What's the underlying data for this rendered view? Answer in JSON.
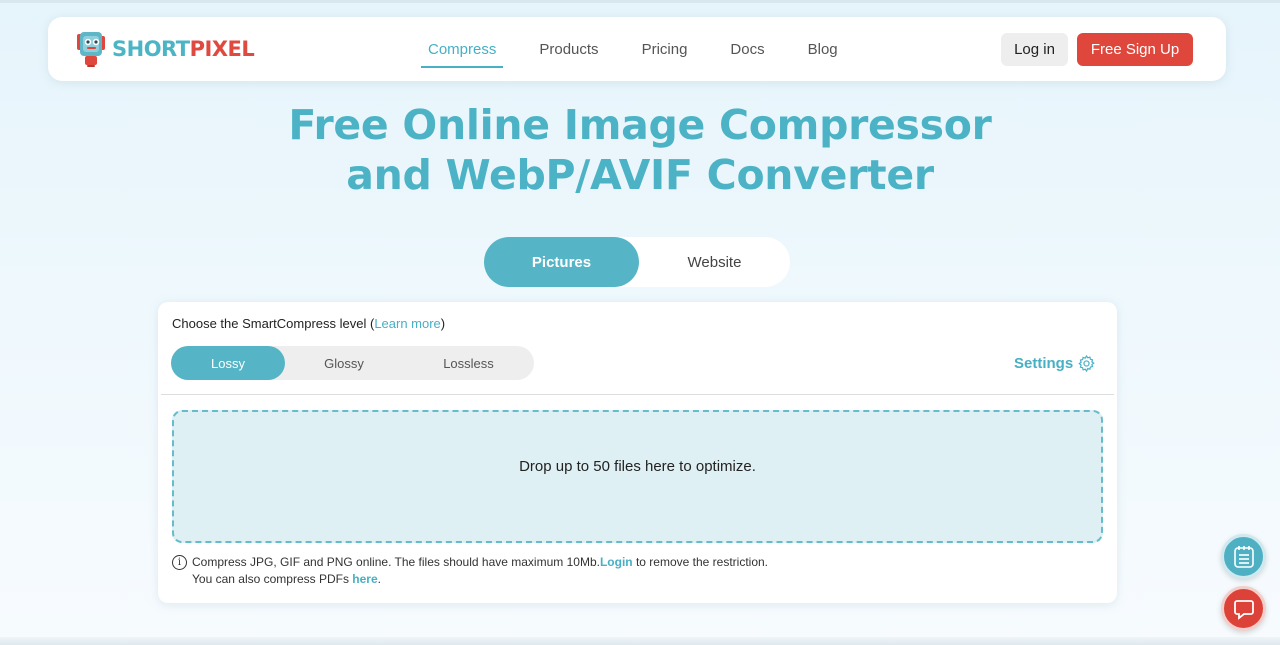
{
  "colors": {
    "accent": "#4bb3c5",
    "brand_red": "#e0473c",
    "dropzone_bg": "#dff0f4"
  },
  "header": {
    "logo": {
      "short": "SHORT",
      "pixel": "PIXEL",
      "icon": "robot-logo-icon"
    },
    "nav": [
      {
        "label": "Compress",
        "active": true
      },
      {
        "label": "Products",
        "active": false
      },
      {
        "label": "Pricing",
        "active": false
      },
      {
        "label": "Docs",
        "active": false
      },
      {
        "label": "Blog",
        "active": false
      }
    ],
    "login_label": "Log in",
    "signup_label": "Free Sign Up"
  },
  "hero": {
    "title_line1": "Free Online Image Compressor",
    "title_line2": "and WebP/AVIF Converter"
  },
  "mode_toggle": {
    "pictures": "Pictures",
    "website": "Website",
    "selected": "Pictures"
  },
  "card": {
    "level_prefix": "Choose the SmartCompress level (",
    "level_link": "Learn more",
    "level_suffix": ")",
    "levels": [
      "Lossy",
      "Glossy",
      "Lossless"
    ],
    "selected_level": "Lossy",
    "settings_label": "Settings",
    "dropzone_text": "Drop up to 50 files here to optimize.",
    "info_line1_a": "Compress JPG, GIF and PNG online. The files should have maximum 10Mb. ",
    "info_line1_link": "Login",
    "info_line1_b": " to remove the restriction.",
    "info_line2_a": "You can also compress PDFs ",
    "info_line2_link": "here",
    "info_line2_b": "."
  },
  "floating": {
    "notes_icon": "notes-icon",
    "chat_icon": "chat-icon"
  }
}
